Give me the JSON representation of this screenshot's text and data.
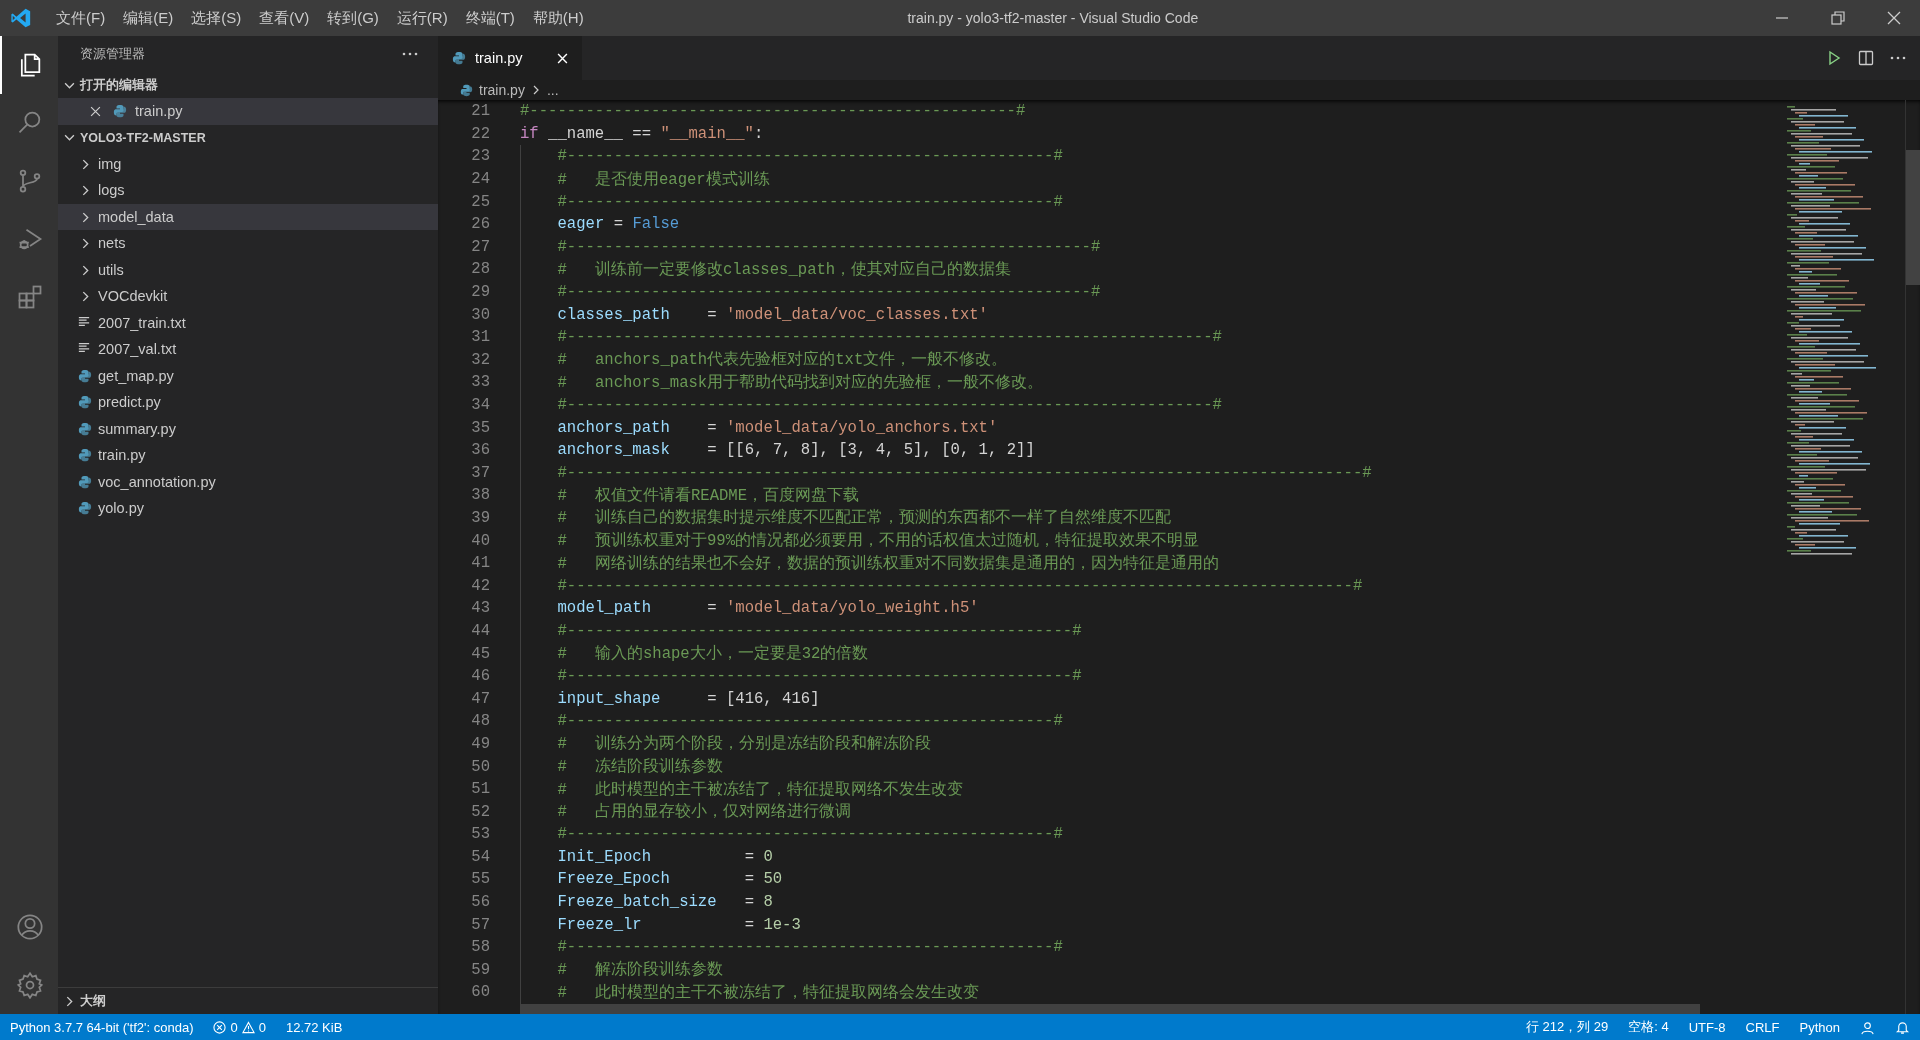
{
  "menu_bar": {
    "items": [
      "文件(F)",
      "编辑(E)",
      "选择(S)",
      "查看(V)",
      "转到(G)",
      "运行(R)",
      "终端(T)",
      "帮助(H)"
    ]
  },
  "window": {
    "title": "train.py - yolo3-tf2-master - Visual Studio Code"
  },
  "activity_bar": {
    "top": [
      {
        "kind": "explorer",
        "selected": true
      },
      {
        "kind": "search",
        "selected": false
      },
      {
        "kind": "source-control",
        "selected": false
      },
      {
        "kind": "run-debug",
        "selected": false
      },
      {
        "kind": "extensions",
        "selected": false
      }
    ],
    "bottom": [
      {
        "kind": "account",
        "selected": false
      },
      {
        "kind": "settings",
        "selected": false
      }
    ]
  },
  "sidebar": {
    "title": "资源管理器",
    "sections": [
      {
        "title": "打开的编辑器",
        "expanded": true,
        "items": [
          {
            "name": "train.py",
            "kind": "python",
            "closable": true,
            "selected": true
          }
        ]
      },
      {
        "title": "YOLO3-TF2-MASTER",
        "expanded": true,
        "items": [
          {
            "name": "img",
            "kind": "folder",
            "expanded": false,
            "selected": false
          },
          {
            "name": "logs",
            "kind": "folder",
            "expanded": false,
            "selected": false
          },
          {
            "name": "model_data",
            "kind": "folder",
            "expanded": false,
            "selected": true
          },
          {
            "name": "nets",
            "kind": "folder",
            "expanded": false,
            "selected": false
          },
          {
            "name": "utils",
            "kind": "folder",
            "expanded": false,
            "selected": false
          },
          {
            "name": "VOCdevkit",
            "kind": "folder",
            "expanded": false,
            "selected": false
          },
          {
            "name": "2007_train.txt",
            "kind": "text",
            "selected": false
          },
          {
            "name": "2007_val.txt",
            "kind": "text",
            "selected": false
          },
          {
            "name": "get_map.py",
            "kind": "python",
            "selected": false
          },
          {
            "name": "predict.py",
            "kind": "python",
            "selected": false
          },
          {
            "name": "summary.py",
            "kind": "python",
            "selected": false
          },
          {
            "name": "train.py",
            "kind": "python",
            "selected": false
          },
          {
            "name": "voc_annotation.py",
            "kind": "python",
            "selected": false
          },
          {
            "name": "yolo.py",
            "kind": "python",
            "selected": false
          }
        ]
      },
      {
        "title": "大纲",
        "expanded": false
      }
    ]
  },
  "tabs": [
    {
      "label": "train.py",
      "kind": "python",
      "selected": true
    }
  ],
  "breadcrumb": {
    "file": "train.py",
    "rest": "..."
  },
  "editor": {
    "lines": [
      {
        "number": "21",
        "indented": false,
        "tokens": [
          {
            "kind": "comment",
            "text": "#----------------------------------------------------#"
          }
        ]
      },
      {
        "number": "22",
        "indented": false,
        "tokens": [
          {
            "kind": "keyword",
            "text": "if"
          },
          {
            "kind": "plain",
            "text": " __name__ == "
          },
          {
            "kind": "string",
            "text": "\"__main__\""
          },
          {
            "kind": "plain",
            "text": ":"
          }
        ]
      },
      {
        "number": "23",
        "indented": true,
        "tokens": [
          {
            "kind": "comment",
            "text": "#----------------------------------------------------#"
          }
        ]
      },
      {
        "number": "24",
        "indented": true,
        "tokens": [
          {
            "kind": "comment",
            "text": "#   是否使用eager模式训练"
          }
        ]
      },
      {
        "number": "25",
        "indented": true,
        "tokens": [
          {
            "kind": "comment",
            "text": "#----------------------------------------------------#"
          }
        ]
      },
      {
        "number": "26",
        "indented": true,
        "tokens": [
          {
            "kind": "variable",
            "text": "eager"
          },
          {
            "kind": "plain",
            "text": " = "
          },
          {
            "kind": "constant",
            "text": "False"
          }
        ]
      },
      {
        "number": "27",
        "indented": true,
        "tokens": [
          {
            "kind": "comment",
            "text": "#--------------------------------------------------------#"
          }
        ]
      },
      {
        "number": "28",
        "indented": true,
        "tokens": [
          {
            "kind": "comment",
            "text": "#   训练前一定要修改classes_path，使其对应自己的数据集"
          }
        ]
      },
      {
        "number": "29",
        "indented": true,
        "tokens": [
          {
            "kind": "comment",
            "text": "#--------------------------------------------------------#"
          }
        ]
      },
      {
        "number": "30",
        "indented": true,
        "tokens": [
          {
            "kind": "variable",
            "text": "classes_path"
          },
          {
            "kind": "plain",
            "text": "    = "
          },
          {
            "kind": "string",
            "text": "'model_data/voc_classes.txt'"
          }
        ]
      },
      {
        "number": "31",
        "indented": true,
        "tokens": [
          {
            "kind": "comment",
            "text": "#---------------------------------------------------------------------#"
          }
        ]
      },
      {
        "number": "32",
        "indented": true,
        "tokens": [
          {
            "kind": "comment",
            "text": "#   anchors_path代表先验框对应的txt文件，一般不修改。"
          }
        ]
      },
      {
        "number": "33",
        "indented": true,
        "tokens": [
          {
            "kind": "comment",
            "text": "#   anchors_mask用于帮助代码找到对应的先验框，一般不修改。"
          }
        ]
      },
      {
        "number": "34",
        "indented": true,
        "tokens": [
          {
            "kind": "comment",
            "text": "#---------------------------------------------------------------------#"
          }
        ]
      },
      {
        "number": "35",
        "indented": true,
        "tokens": [
          {
            "kind": "variable",
            "text": "anchors_path"
          },
          {
            "kind": "plain",
            "text": "    = "
          },
          {
            "kind": "string",
            "text": "'model_data/yolo_anchors.txt'"
          }
        ]
      },
      {
        "number": "36",
        "indented": true,
        "tokens": [
          {
            "kind": "variable",
            "text": "anchors_mask"
          },
          {
            "kind": "plain",
            "text": "    = [[6, 7, 8], [3, 4, 5], [0, 1, 2]]"
          }
        ]
      },
      {
        "number": "37",
        "indented": true,
        "tokens": [
          {
            "kind": "comment",
            "text": "#-------------------------------------------------------------------------------------#"
          }
        ]
      },
      {
        "number": "38",
        "indented": true,
        "tokens": [
          {
            "kind": "comment",
            "text": "#   权值文件请看README，百度网盘下载"
          }
        ]
      },
      {
        "number": "39",
        "indented": true,
        "tokens": [
          {
            "kind": "comment",
            "text": "#   训练自己的数据集时提示维度不匹配正常，预测的东西都不一样了自然维度不匹配"
          }
        ]
      },
      {
        "number": "40",
        "indented": true,
        "tokens": [
          {
            "kind": "comment",
            "text": "#   预训练权重对于99%的情况都必须要用，不用的话权值太过随机，特征提取效果不明显"
          }
        ]
      },
      {
        "number": "41",
        "indented": true,
        "tokens": [
          {
            "kind": "comment",
            "text": "#   网络训练的结果也不会好，数据的预训练权重对不同数据集是通用的，因为特征是通用的"
          }
        ]
      },
      {
        "number": "42",
        "indented": true,
        "tokens": [
          {
            "kind": "comment",
            "text": "#------------------------------------------------------------------------------------#"
          }
        ]
      },
      {
        "number": "43",
        "indented": true,
        "tokens": [
          {
            "kind": "variable",
            "text": "model_path"
          },
          {
            "kind": "plain",
            "text": "      = "
          },
          {
            "kind": "string",
            "text": "'model_data/yolo_weight.h5'"
          }
        ]
      },
      {
        "number": "44",
        "indented": true,
        "tokens": [
          {
            "kind": "comment",
            "text": "#------------------------------------------------------#"
          }
        ]
      },
      {
        "number": "45",
        "indented": true,
        "tokens": [
          {
            "kind": "comment",
            "text": "#   输入的shape大小，一定要是32的倍数"
          }
        ]
      },
      {
        "number": "46",
        "indented": true,
        "tokens": [
          {
            "kind": "comment",
            "text": "#------------------------------------------------------#"
          }
        ]
      },
      {
        "number": "47",
        "indented": true,
        "tokens": [
          {
            "kind": "variable",
            "text": "input_shape"
          },
          {
            "kind": "plain",
            "text": "     = [416, 416]"
          }
        ]
      },
      {
        "number": "48",
        "indented": true,
        "tokens": [
          {
            "kind": "comment",
            "text": "#----------------------------------------------------#"
          }
        ]
      },
      {
        "number": "49",
        "indented": true,
        "tokens": [
          {
            "kind": "comment",
            "text": "#   训练分为两个阶段，分别是冻结阶段和解冻阶段"
          }
        ]
      },
      {
        "number": "50",
        "indented": true,
        "tokens": [
          {
            "kind": "comment",
            "text": "#   冻结阶段训练参数"
          }
        ]
      },
      {
        "number": "51",
        "indented": true,
        "tokens": [
          {
            "kind": "comment",
            "text": "#   此时模型的主干被冻结了，特征提取网络不发生改变"
          }
        ]
      },
      {
        "number": "52",
        "indented": true,
        "tokens": [
          {
            "kind": "comment",
            "text": "#   占用的显存较小，仅对网络进行微调"
          }
        ]
      },
      {
        "number": "53",
        "indented": true,
        "tokens": [
          {
            "kind": "comment",
            "text": "#----------------------------------------------------#"
          }
        ]
      },
      {
        "number": "54",
        "indented": true,
        "tokens": [
          {
            "kind": "variable",
            "text": "Init_Epoch"
          },
          {
            "kind": "plain",
            "text": "          = "
          },
          {
            "kind": "number",
            "text": "0"
          }
        ]
      },
      {
        "number": "55",
        "indented": true,
        "tokens": [
          {
            "kind": "variable",
            "text": "Freeze_Epoch"
          },
          {
            "kind": "plain",
            "text": "        = "
          },
          {
            "kind": "number",
            "text": "50"
          }
        ]
      },
      {
        "number": "56",
        "indented": true,
        "tokens": [
          {
            "kind": "variable",
            "text": "Freeze_batch_size"
          },
          {
            "kind": "plain",
            "text": "   = "
          },
          {
            "kind": "number",
            "text": "8"
          }
        ]
      },
      {
        "number": "57",
        "indented": true,
        "tokens": [
          {
            "kind": "variable",
            "text": "Freeze_lr"
          },
          {
            "kind": "plain",
            "text": "           = "
          },
          {
            "kind": "number",
            "text": "1e-3"
          }
        ]
      },
      {
        "number": "58",
        "indented": true,
        "tokens": [
          {
            "kind": "comment",
            "text": "#----------------------------------------------------#"
          }
        ]
      },
      {
        "number": "59",
        "indented": true,
        "tokens": [
          {
            "kind": "comment",
            "text": "#   解冻阶段训练参数"
          }
        ]
      },
      {
        "number": "60",
        "indented": true,
        "tokens": [
          {
            "kind": "comment",
            "text": "#   此时模型的主干不被冻结了，特征提取网络会发生改变"
          }
        ]
      }
    ]
  },
  "status_bar": {
    "left": [
      {
        "kind": "text",
        "text": "Python 3.7.7 64-bit ('tf2': conda)"
      },
      {
        "kind": "problems",
        "errors": "0",
        "warnings": "0"
      },
      {
        "kind": "text",
        "text": "12.72 KiB"
      }
    ],
    "right": [
      {
        "kind": "text",
        "text": "行 212，列 29"
      },
      {
        "kind": "text",
        "text": "空格: 4"
      },
      {
        "kind": "text",
        "text": "UTF-8"
      },
      {
        "kind": "text",
        "text": "CRLF"
      },
      {
        "kind": "text",
        "text": "Python"
      }
    ]
  }
}
